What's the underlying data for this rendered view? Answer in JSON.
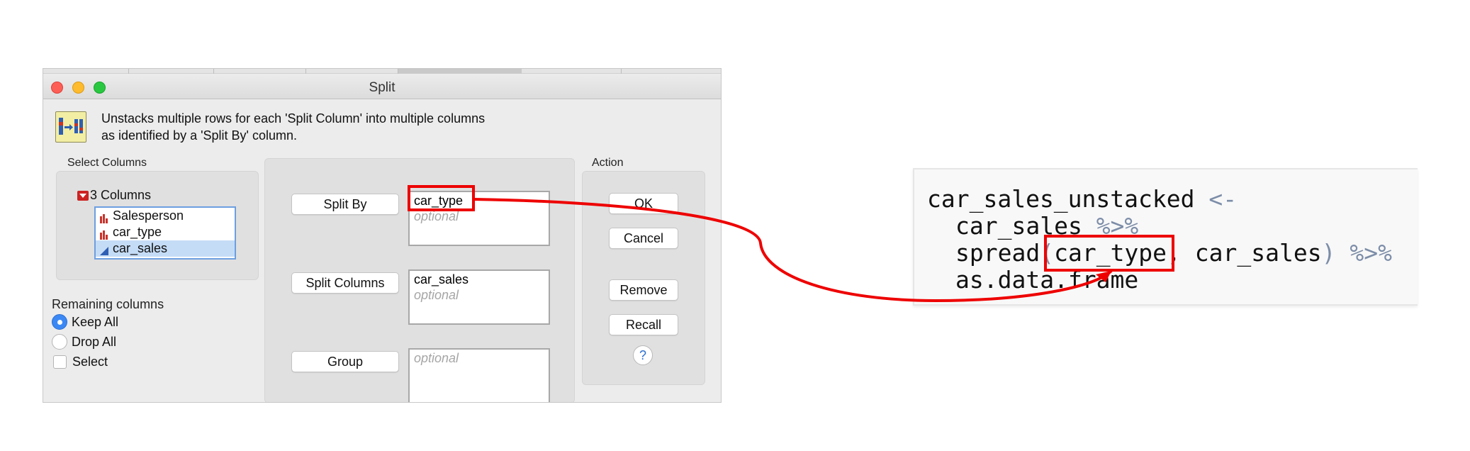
{
  "window": {
    "title": "Split",
    "description_line1": "Unstacks multiple rows for each 'Split Column' into multiple columns",
    "description_line2": "as identified by a 'Split By' column."
  },
  "select_columns": {
    "label": "Select Columns",
    "header": "3 Columns",
    "items": [
      "Salesperson",
      "car_type",
      "car_sales"
    ],
    "selected": "car_sales"
  },
  "fields": {
    "split_by": {
      "label": "Split By",
      "value": "car_type",
      "placeholder": "optional"
    },
    "split_columns": {
      "label": "Split Columns",
      "value": "car_sales",
      "placeholder": "optional"
    },
    "group": {
      "label": "Group",
      "value": "",
      "placeholder": "optional"
    }
  },
  "action": {
    "label": "Action",
    "ok": "OK",
    "cancel": "Cancel",
    "remove": "Remove",
    "recall": "Recall",
    "help": "?"
  },
  "remaining_columns": {
    "label": "Remaining columns",
    "options": [
      "Keep All",
      "Drop All",
      "Select"
    ],
    "selected": "Keep All"
  },
  "code": {
    "line1": {
      "name": "car_sales_unstacked",
      "op": "<-"
    },
    "line2": {
      "name": "car_sales",
      "op": "%>%"
    },
    "line3": {
      "fn": "spread",
      "open": "(",
      "arg1": "car_type",
      "sep": ",",
      "arg2": "car_sales",
      "close": ")",
      "op": "%>%"
    },
    "line4": {
      "name": "as.data.frame"
    }
  },
  "colors": {
    "highlight": "#ee0000",
    "accent_blue": "#3b88f5",
    "operator": "#7c8da8"
  }
}
